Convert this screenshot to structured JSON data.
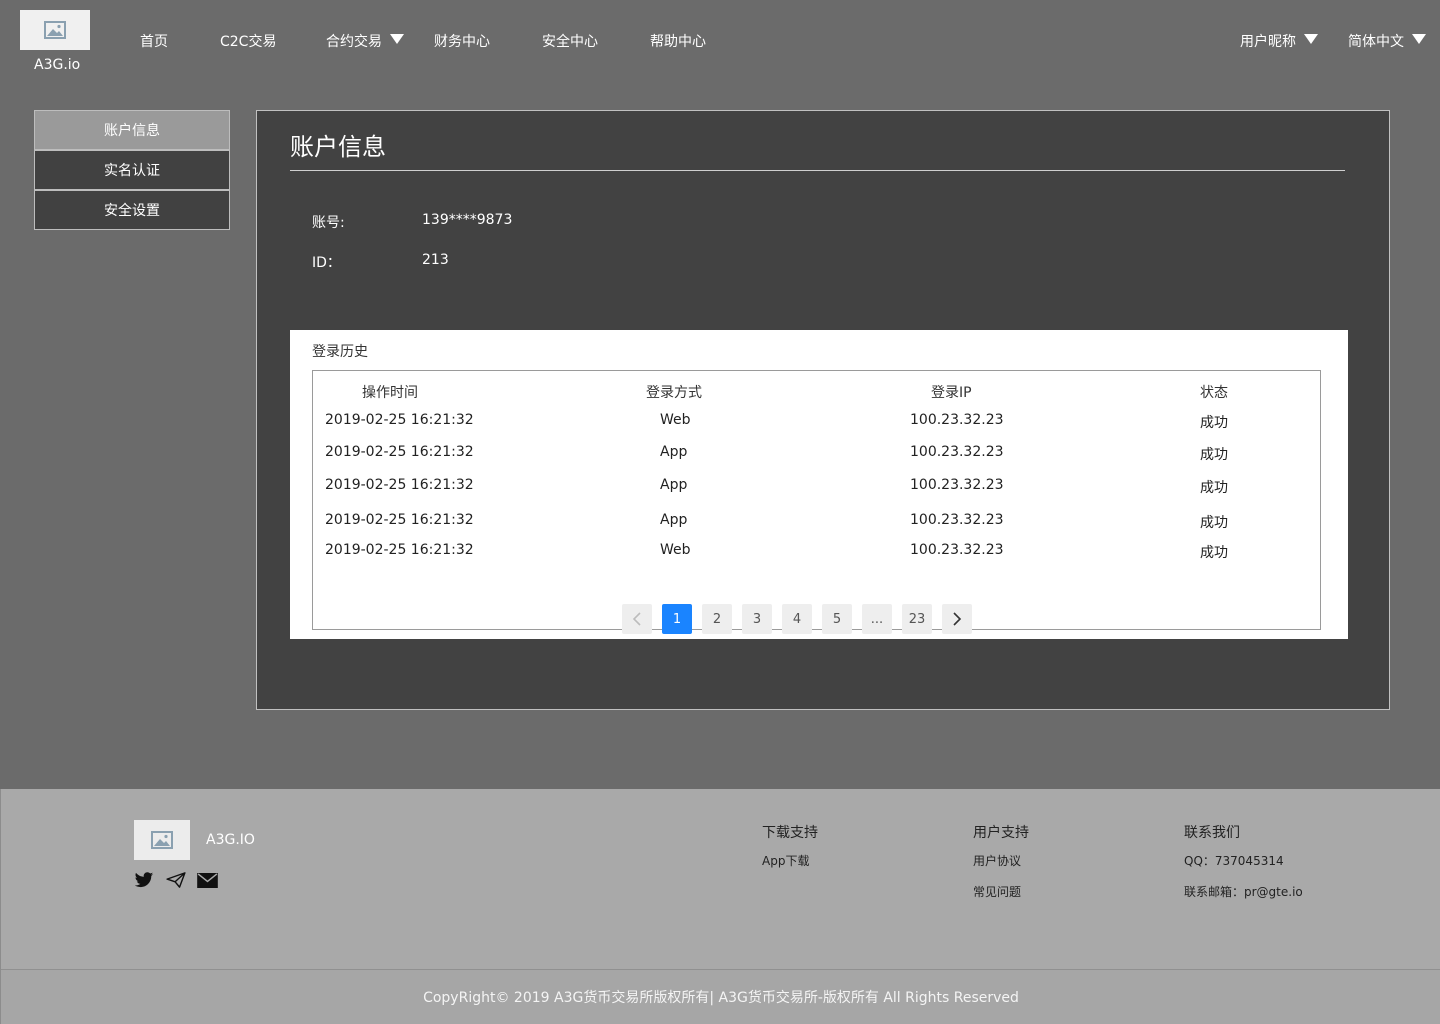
{
  "header": {
    "logo_text": "A3G.io",
    "nav": [
      {
        "label": "首页"
      },
      {
        "label": "C2C交易"
      },
      {
        "label": "合约交易"
      },
      {
        "label": "财务中心"
      },
      {
        "label": "安全中心"
      },
      {
        "label": "帮助中心"
      }
    ],
    "user_nickname": "用户昵称",
    "language": "简体中文"
  },
  "sidebar": {
    "items": [
      {
        "label": "账户信息"
      },
      {
        "label": "实名认证"
      },
      {
        "label": "安全设置"
      }
    ]
  },
  "account": {
    "title": "账户信息",
    "account_label": "账号:",
    "account_value": "139****9873",
    "id_label": "ID：",
    "id_value": "213"
  },
  "login_history": {
    "title": "登录历史",
    "columns": [
      "操作时间",
      "登录方式",
      "登录IP",
      "状态"
    ],
    "rows": [
      {
        "time": "2019-02-25 16:21:32",
        "method": "Web",
        "ip": "100.23.32.23",
        "status": "成功"
      },
      {
        "time": "2019-02-25 16:21:32",
        "method": "App",
        "ip": "100.23.32.23",
        "status": "成功"
      },
      {
        "time": "2019-02-25 16:21:32",
        "method": "App",
        "ip": "100.23.32.23",
        "status": "成功"
      },
      {
        "time": "2019-02-25 16:21:32",
        "method": "App",
        "ip": "100.23.32.23",
        "status": "成功"
      },
      {
        "time": "2019-02-25 16:21:32",
        "method": "Web",
        "ip": "100.23.32.23",
        "status": "成功"
      }
    ],
    "pagination": {
      "pages": [
        "1",
        "2",
        "3",
        "4",
        "5",
        "...",
        "23"
      ],
      "current": "1",
      "accent_color": "#1a84ff"
    }
  },
  "footer": {
    "brand": "A3G.IO",
    "social_icons": [
      "twitter-icon",
      "telegram-icon",
      "mail-icon"
    ],
    "columns": [
      {
        "title": "下载支持",
        "links": [
          "App下载"
        ]
      },
      {
        "title": "用户支持",
        "links": [
          "用户协议",
          "常见问题"
        ]
      },
      {
        "title": "联系我们",
        "links": [
          "QQ：737045314",
          "联系邮箱：pr@gte.io"
        ]
      }
    ],
    "copyright": "CopyRight© 2019 A3G货币交易所版权所有| A3G货币交易所-版权所有 All Rights Reserved"
  }
}
